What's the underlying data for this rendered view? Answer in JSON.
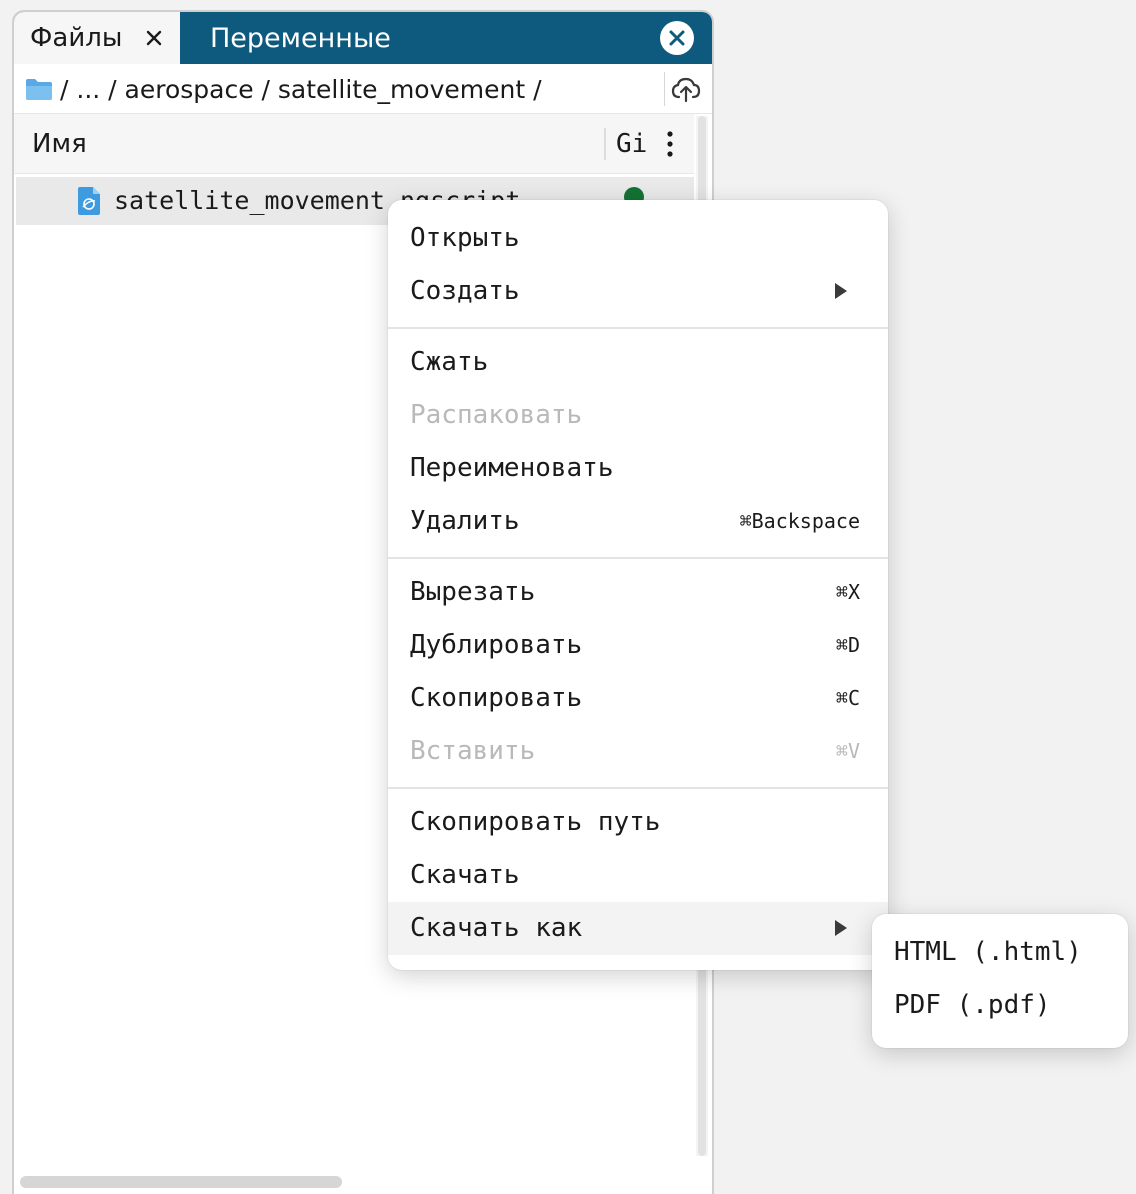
{
  "tabs": {
    "files_label": "Файлы",
    "variables_label": "Переменные"
  },
  "path": {
    "text": "/ ... / aerospace / satellite_movement /"
  },
  "columns": {
    "name": "Имя",
    "git": "Gi"
  },
  "files": [
    {
      "name": "satellite_movement.ngscript",
      "git_status_color": "#137333"
    }
  ],
  "context_menu": {
    "open": "Открыть",
    "create": "Создать",
    "compress": "Сжать",
    "extract": "Распаковать",
    "rename": "Переименовать",
    "delete": "Удалить",
    "delete_shortcut": "⌘Backspace",
    "cut": "Вырезать",
    "cut_shortcut": "⌘X",
    "duplicate": "Дублировать",
    "duplicate_shortcut": "⌘D",
    "copy": "Скопировать",
    "copy_shortcut": "⌘C",
    "paste": "Вставить",
    "paste_shortcut": "⌘V",
    "copy_path": "Скопировать путь",
    "download": "Скачать",
    "download_as": "Скачать как"
  },
  "download_as_menu": {
    "html": "HTML (.html)",
    "pdf": "PDF (.pdf)"
  },
  "colors": {
    "tabbar": "#0e5a7e",
    "folder": "#5aa9e6",
    "git_dot": "#137333",
    "disabled_text": "#b9b9b9"
  }
}
